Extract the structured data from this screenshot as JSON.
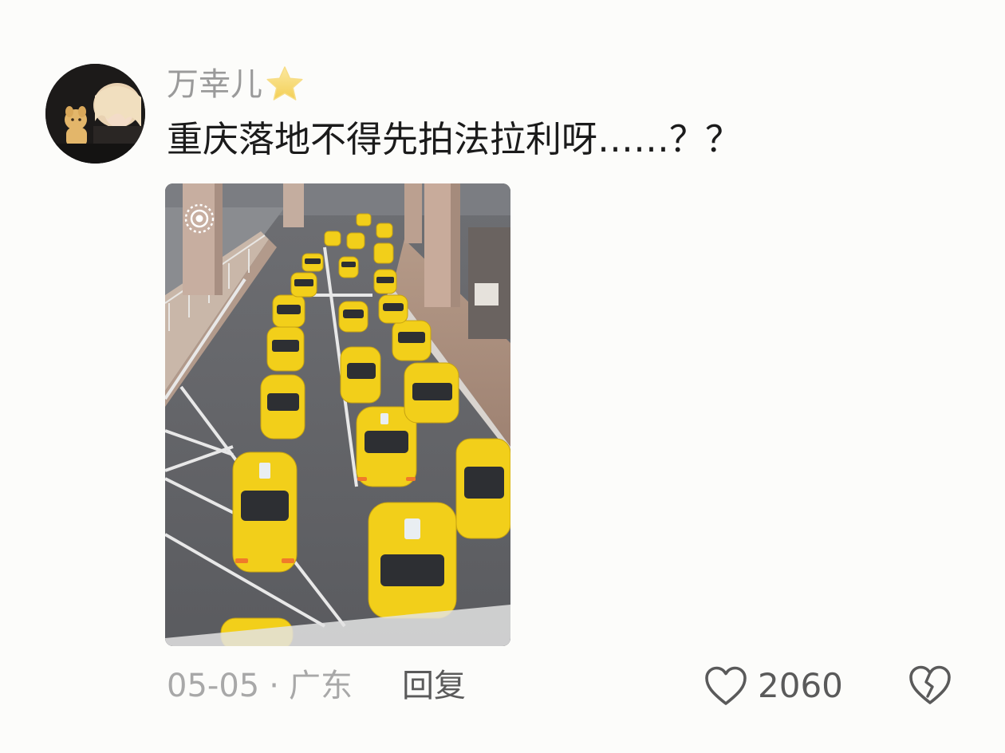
{
  "comment": {
    "username": "万幸儿",
    "badge_icon": "star-badge-icon",
    "text": "重庆落地不得先拍法拉利呀……？？",
    "image_alt": "taxi-queue-photo",
    "date": "05-05",
    "separator": "·",
    "location": "广东",
    "reply_label": "回复",
    "like_count": "2060",
    "like_icon": "heart-icon",
    "dislike_icon": "broken-heart-icon"
  },
  "colors": {
    "background": "#fcfcfa",
    "username": "#9a9a9a",
    "text": "#1b1b1b",
    "meta": "#a8a8a8",
    "action": "#5a5a5a",
    "taxi_yellow": "#f2cf1a",
    "star": "#f5d66b"
  }
}
